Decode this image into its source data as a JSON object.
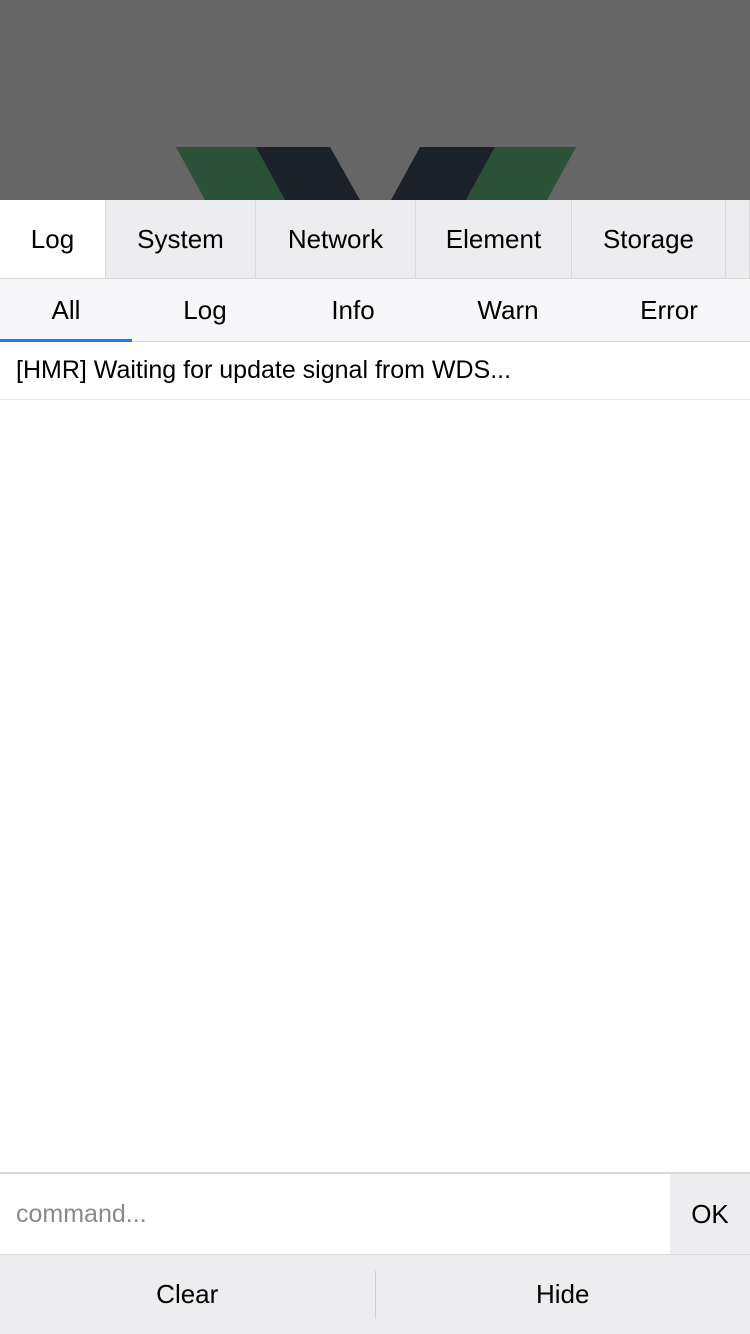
{
  "main_tabs": [
    {
      "label": "Log",
      "active": true
    },
    {
      "label": "System",
      "active": false
    },
    {
      "label": "Network",
      "active": false
    },
    {
      "label": "Element",
      "active": false
    },
    {
      "label": "Storage",
      "active": false
    }
  ],
  "sub_tabs": [
    {
      "label": "All",
      "active": true
    },
    {
      "label": "Log",
      "active": false
    },
    {
      "label": "Info",
      "active": false
    },
    {
      "label": "Warn",
      "active": false
    },
    {
      "label": "Error",
      "active": false
    }
  ],
  "log_entries": [
    {
      "text": "[HMR] Waiting for update signal from WDS..."
    }
  ],
  "command": {
    "value": "",
    "placeholder": "command...",
    "submit_label": "OK"
  },
  "footer": {
    "clear_label": "Clear",
    "hide_label": "Hide"
  },
  "colors": {
    "accent": "#1f7ae0",
    "backdrop": "#666666",
    "logo_green": "#2b5138",
    "logo_dark": "#1b2129"
  },
  "icons": {
    "backdrop_logo": "vue-logo-icon"
  }
}
